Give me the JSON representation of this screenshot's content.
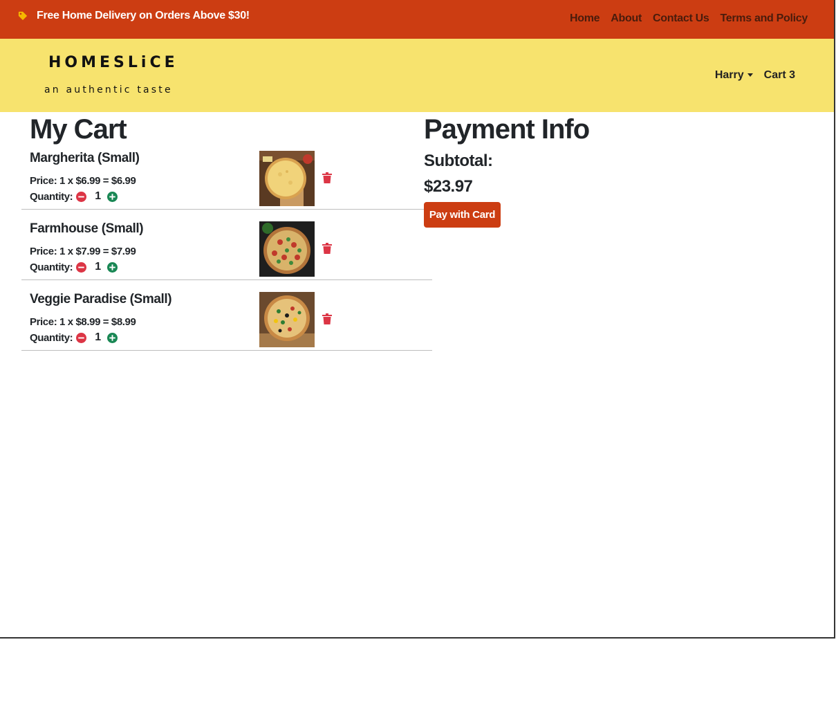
{
  "topbar": {
    "promo_icon": "tag-icon",
    "promo_text": "Free Home Delivery on Orders Above $30!",
    "links": [
      "Home",
      "About",
      "Contact Us",
      "Terms and Policy"
    ]
  },
  "header": {
    "brand_name": "HOMESLiCE",
    "brand_tagline": "an authentic taste",
    "user": "Harry",
    "cart_label": "Cart 3"
  },
  "cart": {
    "title": "My Cart",
    "quantity_label": "Quantity:",
    "items": [
      {
        "name": "Margherita (Small)",
        "price": "Price: 1 x $6.99 = $6.99",
        "qty": "1"
      },
      {
        "name": "Farmhouse (Small)",
        "price": "Price: 1 x $7.99 = $7.99",
        "qty": "1"
      },
      {
        "name": "Veggie Paradise (Small)",
        "price": "Price: 1 x $8.99 = $8.99",
        "qty": "1"
      }
    ]
  },
  "payment": {
    "title": "Payment Info",
    "subtotal_label": "Subtotal:",
    "subtotal_value": "$23.97",
    "pay_button": "Pay with Card"
  },
  "colors": {
    "topbar": "#cc3d12",
    "header": "#f7e36e",
    "minus": "#dc3545",
    "plus": "#198754",
    "trash": "#dc3545"
  }
}
